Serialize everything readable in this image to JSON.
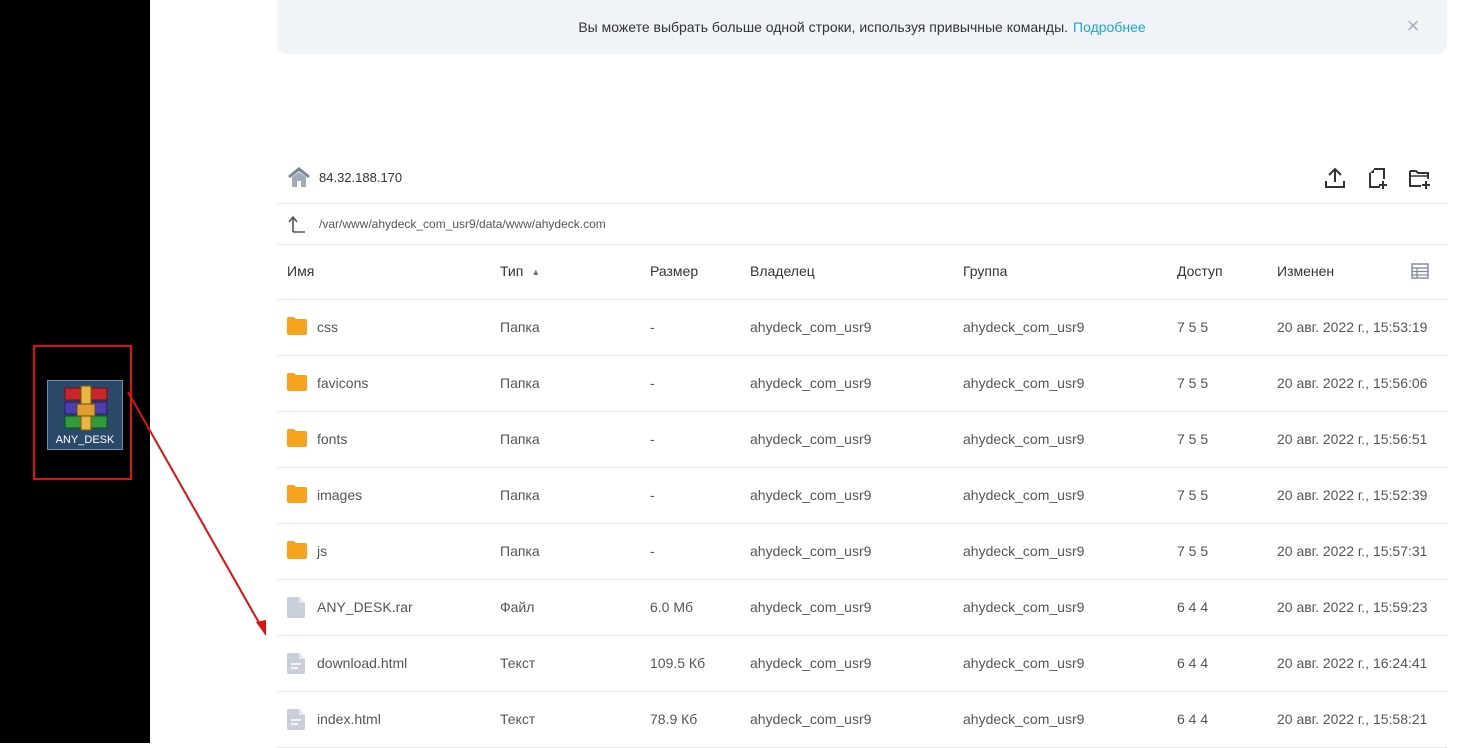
{
  "desktop": {
    "icon_label": "ANY_DESK"
  },
  "notice": {
    "text": "Вы можете выбрать больше одной строки, используя привычные команды.",
    "link": "Подробнее"
  },
  "server": {
    "address": "84.32.188.170"
  },
  "path": "/var/www/ahydeck_com_usr9/data/www/ahydeck.com",
  "table": {
    "headers": {
      "name": "Имя",
      "type": "Тип",
      "size": "Размер",
      "owner": "Владелец",
      "group": "Группа",
      "access": "Доступ",
      "modified": "Изменен"
    },
    "rows": [
      {
        "icon": "folder-icon",
        "name": "css",
        "type": "Папка",
        "size": "-",
        "owner": "ahydeck_com_usr9",
        "group": "ahydeck_com_usr9",
        "access": "7 5 5",
        "modified": "20 авг. 2022 г., 15:53:19"
      },
      {
        "icon": "folder-icon",
        "name": "favicons",
        "type": "Папка",
        "size": "-",
        "owner": "ahydeck_com_usr9",
        "group": "ahydeck_com_usr9",
        "access": "7 5 5",
        "modified": "20 авг. 2022 г., 15:56:06"
      },
      {
        "icon": "folder-icon",
        "name": "fonts",
        "type": "Папка",
        "size": "-",
        "owner": "ahydeck_com_usr9",
        "group": "ahydeck_com_usr9",
        "access": "7 5 5",
        "modified": "20 авг. 2022 г., 15:56:51"
      },
      {
        "icon": "folder-icon",
        "name": "images",
        "type": "Папка",
        "size": "-",
        "owner": "ahydeck_com_usr9",
        "group": "ahydeck_com_usr9",
        "access": "7 5 5",
        "modified": "20 авг. 2022 г., 15:52:39"
      },
      {
        "icon": "folder-icon",
        "name": "js",
        "type": "Папка",
        "size": "-",
        "owner": "ahydeck_com_usr9",
        "group": "ahydeck_com_usr9",
        "access": "7 5 5",
        "modified": "20 авг. 2022 г., 15:57:31"
      },
      {
        "icon": "file-icon",
        "name": "ANY_DESK.rar",
        "type": "Файл",
        "size": "6.0 Мб",
        "owner": "ahydeck_com_usr9",
        "group": "ahydeck_com_usr9",
        "access": "6 4 4",
        "modified": "20 авг. 2022 г., 15:59:23"
      },
      {
        "icon": "text-file-icon",
        "name": "download.html",
        "type": "Текст",
        "size": "109.5 Кб",
        "owner": "ahydeck_com_usr9",
        "group": "ahydeck_com_usr9",
        "access": "6 4 4",
        "modified": "20 авг. 2022 г., 16:24:41"
      },
      {
        "icon": "text-file-icon",
        "name": "index.html",
        "type": "Текст",
        "size": "78.9 Кб",
        "owner": "ahydeck_com_usr9",
        "group": "ahydeck_com_usr9",
        "access": "6 4 4",
        "modified": "20 авг. 2022 г., 15:58:21"
      }
    ]
  },
  "colors": {
    "folder": "#f7a21b",
    "file": "#c8cfd8",
    "link": "#1aa6d8",
    "highlight": "#e01010"
  }
}
